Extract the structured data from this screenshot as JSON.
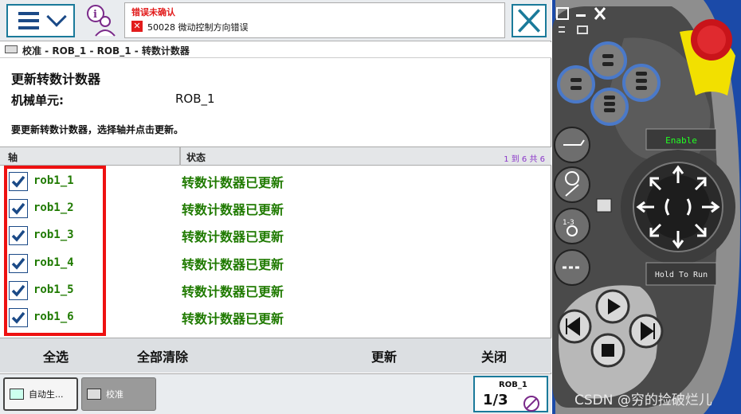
{
  "menu": {
    "icon": "hamburger-icon",
    "dropdown_icon": "chevron-down-icon"
  },
  "event": {
    "title": "错误未确认",
    "code_message": "50028  微动控制方向错误",
    "status_color": "#e21c1c"
  },
  "breadcrumb": "校准 - ROB_1 - ROB_1 - 转数计数器",
  "page_title": "更新转数计数器",
  "unit": {
    "label": "机械单元:",
    "value": "ROB_1"
  },
  "instruction": "要更新转数计数器，选择轴并点击更新。",
  "table": {
    "headers": {
      "axis": "轴",
      "status": "状态"
    },
    "paging": "1 到 6 共 6",
    "rows": [
      {
        "axis": "rob1_1",
        "status": "转数计数器已更新",
        "checked": true
      },
      {
        "axis": "rob1_2",
        "status": "转数计数器已更新",
        "checked": true
      },
      {
        "axis": "rob1_3",
        "status": "转数计数器已更新",
        "checked": true
      },
      {
        "axis": "rob1_4",
        "status": "转数计数器已更新",
        "checked": true
      },
      {
        "axis": "rob1_5",
        "status": "转数计数器已更新",
        "checked": true
      },
      {
        "axis": "rob1_6",
        "status": "转数计数器已更新",
        "checked": true
      }
    ],
    "status_color": "#1f7a00"
  },
  "actions": {
    "select_all": "全选",
    "clear_all": "全部清除",
    "update": "更新",
    "close": "关闭"
  },
  "tasks": {
    "auto": "自动生...",
    "calibrate": "校准"
  },
  "quickset": {
    "title": "ROB_1",
    "fraction": "1/3"
  },
  "pendant": {
    "enable": "Enable",
    "hold_to_run": "Hold To Run"
  },
  "watermark": "CSDN @穷的捡破烂儿"
}
